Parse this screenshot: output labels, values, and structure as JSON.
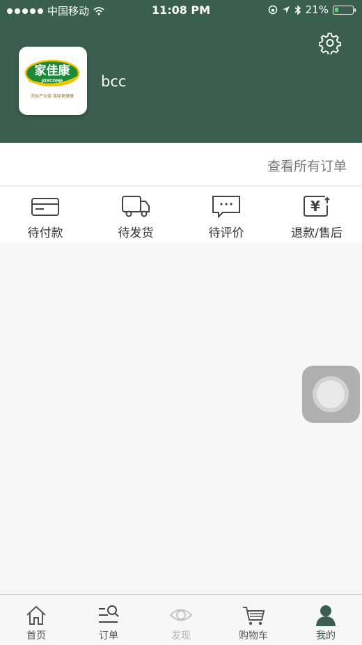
{
  "status_bar": {
    "carrier": "中国移动",
    "time": "11:08 PM",
    "battery": "21%",
    "battery_level": 0.21
  },
  "profile": {
    "username": "bcc",
    "logo_text_cn": "家佳康",
    "logo_text_en": "JOYCOME",
    "logo_slogan": "肉食产业链 美味更健康"
  },
  "orders": {
    "view_all_label": "查看所有订单",
    "statuses": [
      {
        "label": "待付款",
        "icon": "card-icon"
      },
      {
        "label": "待发货",
        "icon": "truck-icon"
      },
      {
        "label": "待评价",
        "icon": "comment-icon"
      },
      {
        "label": "退款/售后",
        "icon": "refund-icon"
      }
    ]
  },
  "tabbar": {
    "tabs": [
      {
        "label": "首页",
        "icon": "home-icon"
      },
      {
        "label": "订单",
        "icon": "order-search-icon"
      },
      {
        "label": "发现",
        "icon": "eye-icon"
      },
      {
        "label": "购物车",
        "icon": "cart-icon"
      },
      {
        "label": "我的",
        "icon": "user-icon"
      }
    ],
    "active_index": 4
  },
  "colors": {
    "header_bg": "#3a5f4e",
    "active_tab": "#3a5f4e",
    "inactive_tab": "#555555",
    "disabled_tab": "#b5b5b5"
  }
}
